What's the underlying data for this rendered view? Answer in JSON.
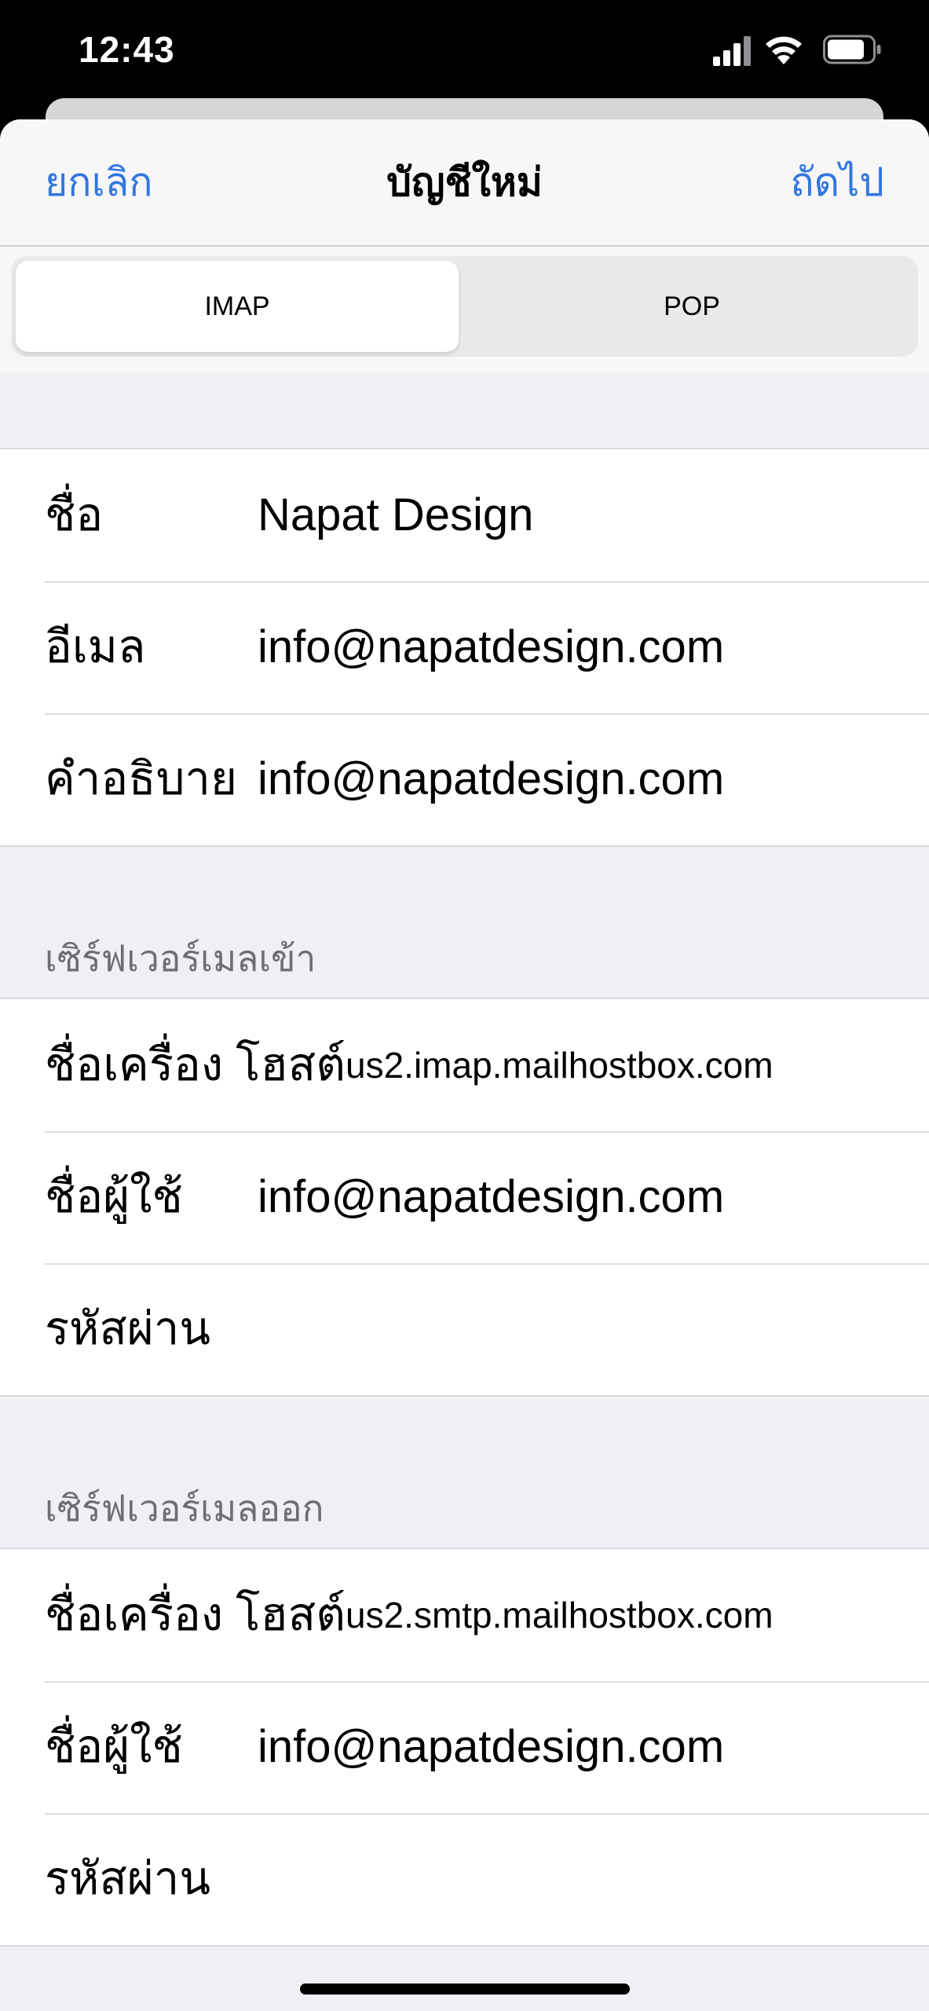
{
  "status_bar": {
    "time": "12:43",
    "icons": [
      "cellular-signal-icon",
      "wifi-icon",
      "battery-icon"
    ]
  },
  "nav": {
    "cancel_label": "ยกเลิก",
    "title": "บัญชีใหม่",
    "next_label": "ถัดไป"
  },
  "segmented": {
    "options": [
      "IMAP",
      "POP"
    ],
    "selected": "IMAP"
  },
  "account": {
    "name_label": "ชื่อ",
    "name_value": "Napat Design",
    "email_label": "อีเมล",
    "email_value": "info@napatdesign.com",
    "description_label": "คำอธิบาย",
    "description_value": "info@napatdesign.com"
  },
  "incoming": {
    "header": "เซิร์ฟเวอร์เมลเข้า",
    "host_label": "ชื่อเครื่อง โฮสต์",
    "host_value": "us2.imap.mailhostbox.com",
    "username_label": "ชื่อผู้ใช้",
    "username_value": "info@napatdesign.com",
    "password_label": "รหัสผ่าน",
    "password_value": ""
  },
  "outgoing": {
    "header": "เซิร์ฟเวอร์เมลออก",
    "host_label": "ชื่อเครื่อง โฮสต์",
    "host_value": "us2.smtp.mailhostbox.com",
    "username_label": "ชื่อผู้ใช้",
    "username_value": "info@napatdesign.com",
    "password_label": "รหัสผ่าน",
    "password_value": ""
  },
  "colors": {
    "accent": "#3377e0",
    "background": "#efeff4",
    "secondary_text": "#6d6d72"
  }
}
